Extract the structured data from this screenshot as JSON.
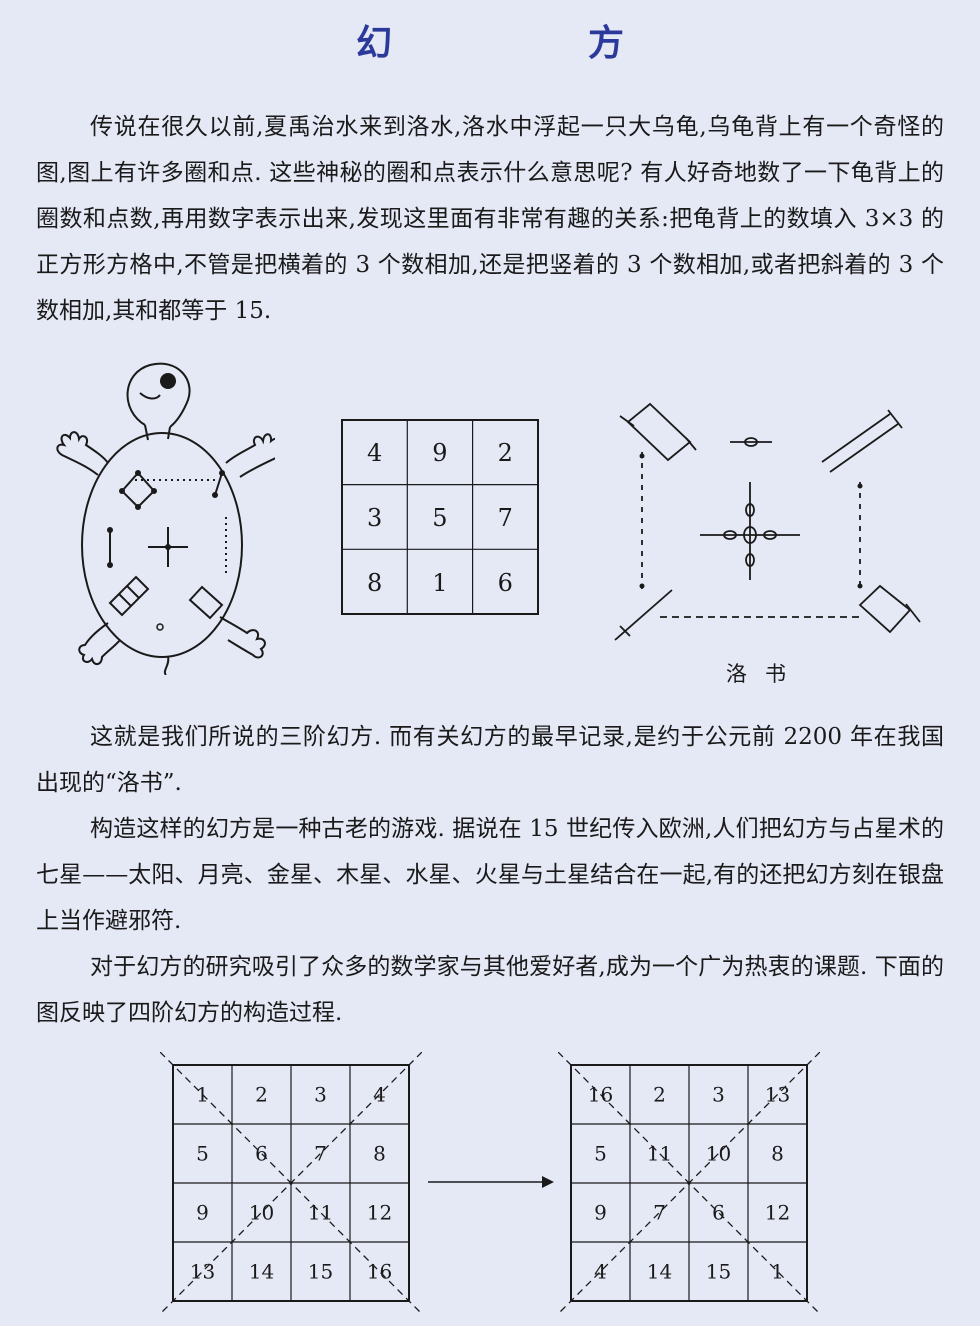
{
  "page": {
    "title": "幻　方",
    "paragraphs": [
      "传说在很久以前,夏禹治水来到洛水,洛水中浮起一只大乌龟,乌龟背上有一个奇怪的图,图上有许多圈和点. 这些神秘的圈和点表示什么意思呢? 有人好奇地数了一下龟背上的圈数和点数,再用数字表示出来,发现这里面有非常有趣的关系:把龟背上的数填入 3×3 的正方形方格中,不管是把横着的 3 个数相加,还是把竖着的 3 个数相加,或者把斜着的 3 个数相加,其和都等于 15.",
      "这就是我们所说的三阶幻方. 而有关幻方的最早记录,是约于公元前 2200 年在我国出现的“洛书”.",
      "构造这样的幻方是一种古老的游戏. 据说在 15 世纪传入欧洲,人们把幻方与占星术的七星——太阳、月亮、金星、木星、水星、火星与土星结合在一起,有的还把幻方刻在银盘上当作避邪符.",
      "对于幻方的研究吸引了众多的数学家与其他爱好者,成为一个广为热衷的课题. 下面的图反映了四阶幻方的构造过程."
    ],
    "luoshu_caption": "洛书"
  },
  "magic3": [
    [
      4,
      9,
      2
    ],
    [
      3,
      5,
      7
    ],
    [
      8,
      1,
      6
    ]
  ],
  "magic4_before": [
    [
      1,
      2,
      3,
      4
    ],
    [
      5,
      6,
      7,
      8
    ],
    [
      9,
      10,
      11,
      12
    ],
    [
      13,
      14,
      15,
      16
    ]
  ],
  "magic4_after": [
    [
      16,
      2,
      3,
      13
    ],
    [
      5,
      11,
      10,
      8
    ],
    [
      9,
      7,
      6,
      12
    ],
    [
      4,
      14,
      15,
      1
    ]
  ],
  "colors": {
    "background": "#e5e8f5",
    "title": "#2b3a9a",
    "ink": "#1a1a1a"
  }
}
